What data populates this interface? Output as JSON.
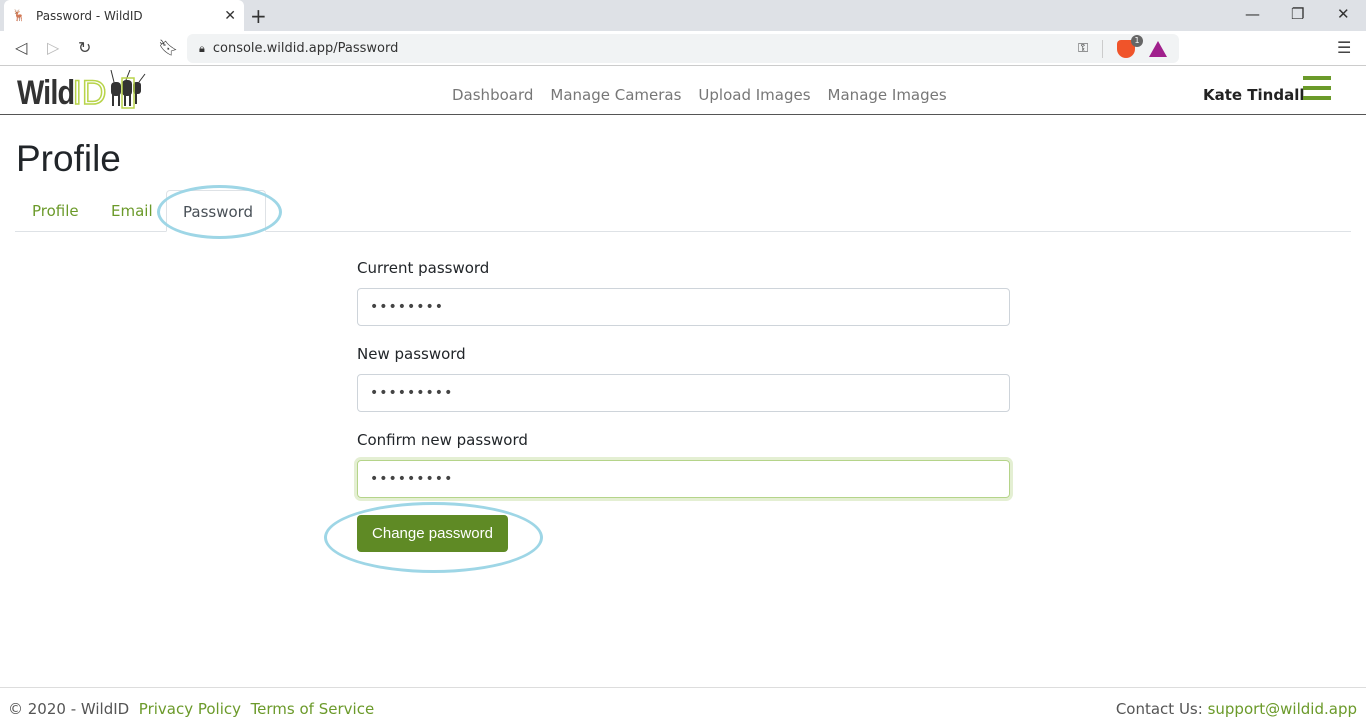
{
  "browser": {
    "tab_title": "Password - WildID",
    "url": "console.wildid.app/Password",
    "extension_badge": "1"
  },
  "header": {
    "logo": "WildID",
    "logo_wild": "Wild",
    "logo_id": "ID",
    "nav": [
      "Dashboard",
      "Manage Cameras",
      "Upload Images",
      "Manage Images"
    ],
    "user": "Kate Tindall",
    "accent": "#6b9a2a"
  },
  "page": {
    "title": "Profile",
    "tabs": [
      "Profile",
      "Email",
      "Password"
    ],
    "active_tab": "Password"
  },
  "form": {
    "current": {
      "label": "Current password",
      "value": "••••••••"
    },
    "new": {
      "label": "New password",
      "value": "•••••••••"
    },
    "confirm": {
      "label": "Confirm new password",
      "value": "•••••••••"
    },
    "submit": "Change password"
  },
  "footer": {
    "copyright": "© 2020 - WildID",
    "privacy": "Privacy Policy",
    "terms": "Terms of Service",
    "contact_label": "Contact Us:",
    "email": "support@wildid.app"
  }
}
